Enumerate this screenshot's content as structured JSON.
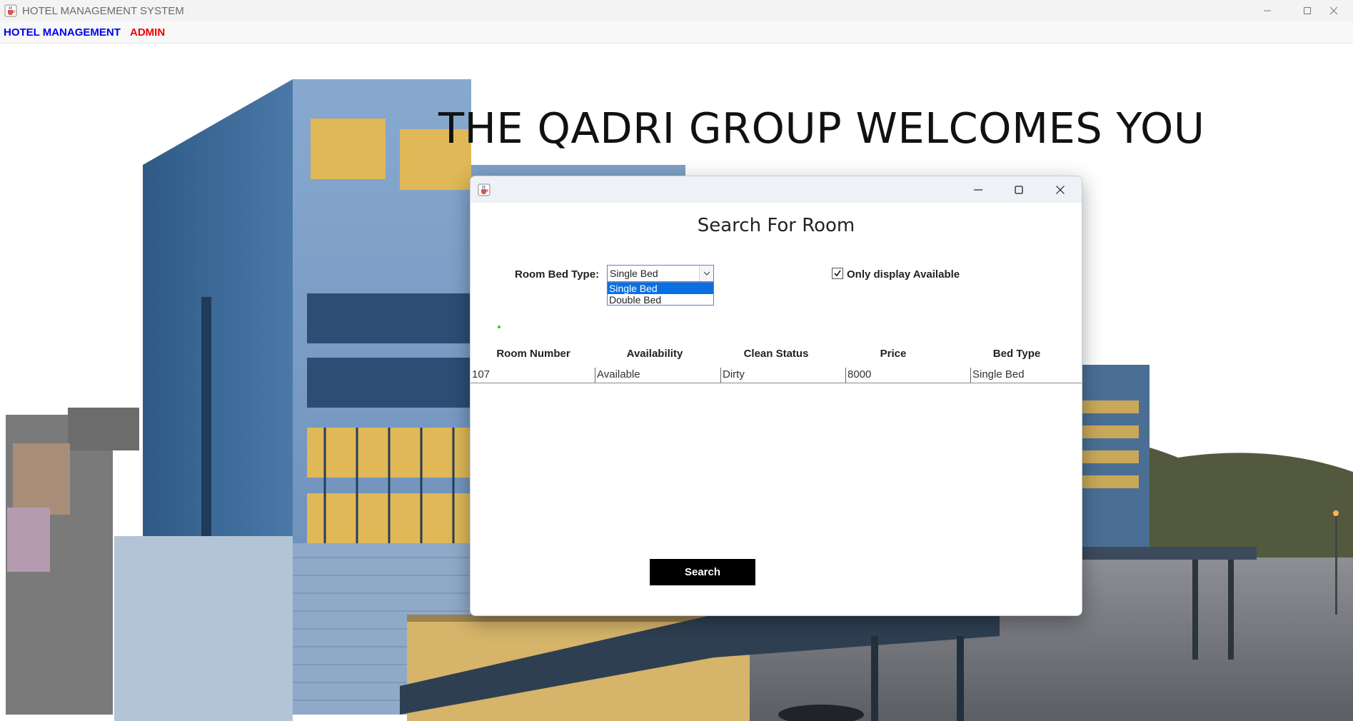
{
  "window": {
    "title": "HOTEL MANAGEMENT SYSTEM",
    "icon": "java-cup-icon"
  },
  "menu": {
    "items": [
      {
        "label": "HOTEL MANAGEMENT",
        "color": "#0000ee"
      },
      {
        "label": "ADMIN",
        "color": "#ee0000"
      }
    ]
  },
  "background": {
    "welcome_text": "THE QADRI GROUP WELCOMES YOU",
    "image": "hotel-building-photo"
  },
  "dialog": {
    "title": "",
    "icon": "java-cup-icon",
    "heading": "Search For Room",
    "bed_type": {
      "label": "Room Bed Type:",
      "selected": "Single Bed",
      "options": [
        "Single Bed",
        "Double Bed"
      ],
      "expanded": true
    },
    "only_available": {
      "label": "Only display Available",
      "checked": true
    },
    "status_indicator_color": "#22cc22",
    "table": {
      "columns": [
        "Room Number",
        "Availability",
        "Clean Status",
        "Price",
        "Bed Type"
      ],
      "rows": [
        [
          "107",
          "Available",
          "Dirty",
          "8000",
          "Single Bed"
        ]
      ]
    },
    "search_button": "Search"
  },
  "colors": {
    "accent_selection": "#0a6fe0",
    "button_bg": "#000000",
    "button_text": "#ffffff"
  }
}
